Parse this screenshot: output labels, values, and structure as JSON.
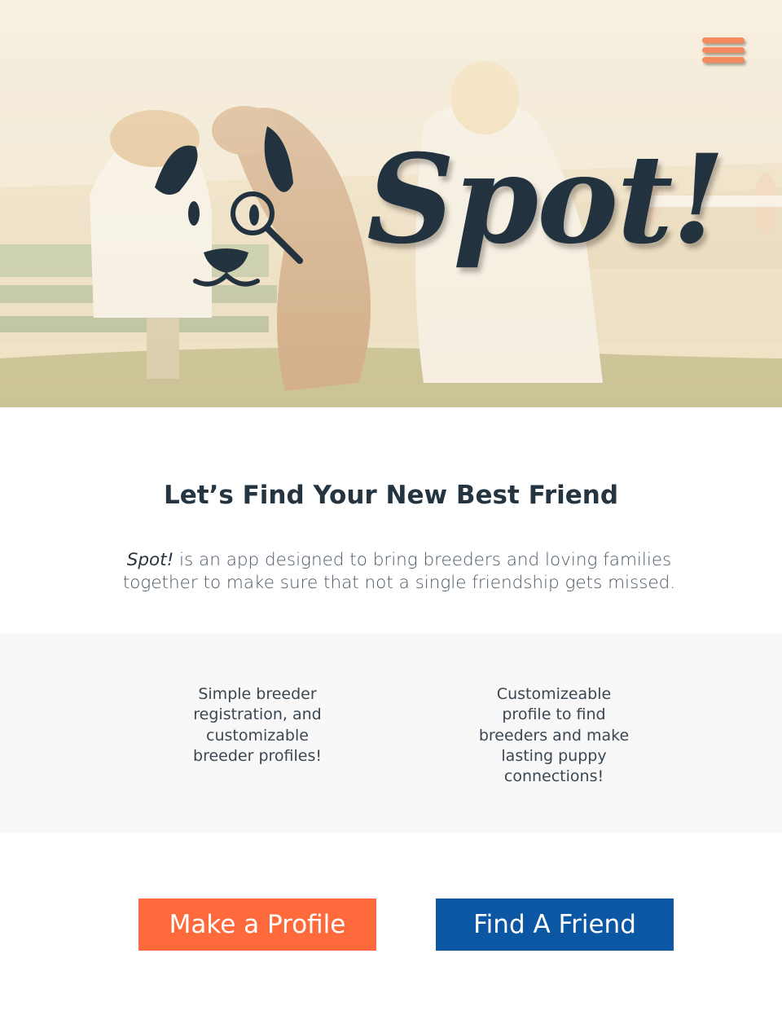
{
  "hero": {
    "logo_text": "Spot!",
    "logo_icon": "dog-face-magnifier-icon",
    "menu_icon": "hamburger-menu-icon",
    "colors": {
      "menu": "#f48a5e",
      "logo": "#23323f"
    }
  },
  "intro": {
    "headline": "Let’s Find Your New Best Friend",
    "brand": "Spot!",
    "body": " is an app designed to bring breeders and loving families together to make sure that not a single friendship gets missed."
  },
  "features": [
    {
      "text": "Simple breeder registration, and customizable breeder profiles!"
    },
    {
      "text": "Customizeable profile to find breeders and make lasting puppy connections!"
    }
  ],
  "actions": {
    "make_profile": "Make a Profile",
    "find_friend": "Find A Friend",
    "colors": {
      "make_profile": "#ff6a3c",
      "find_friend": "#0b57a4"
    }
  }
}
